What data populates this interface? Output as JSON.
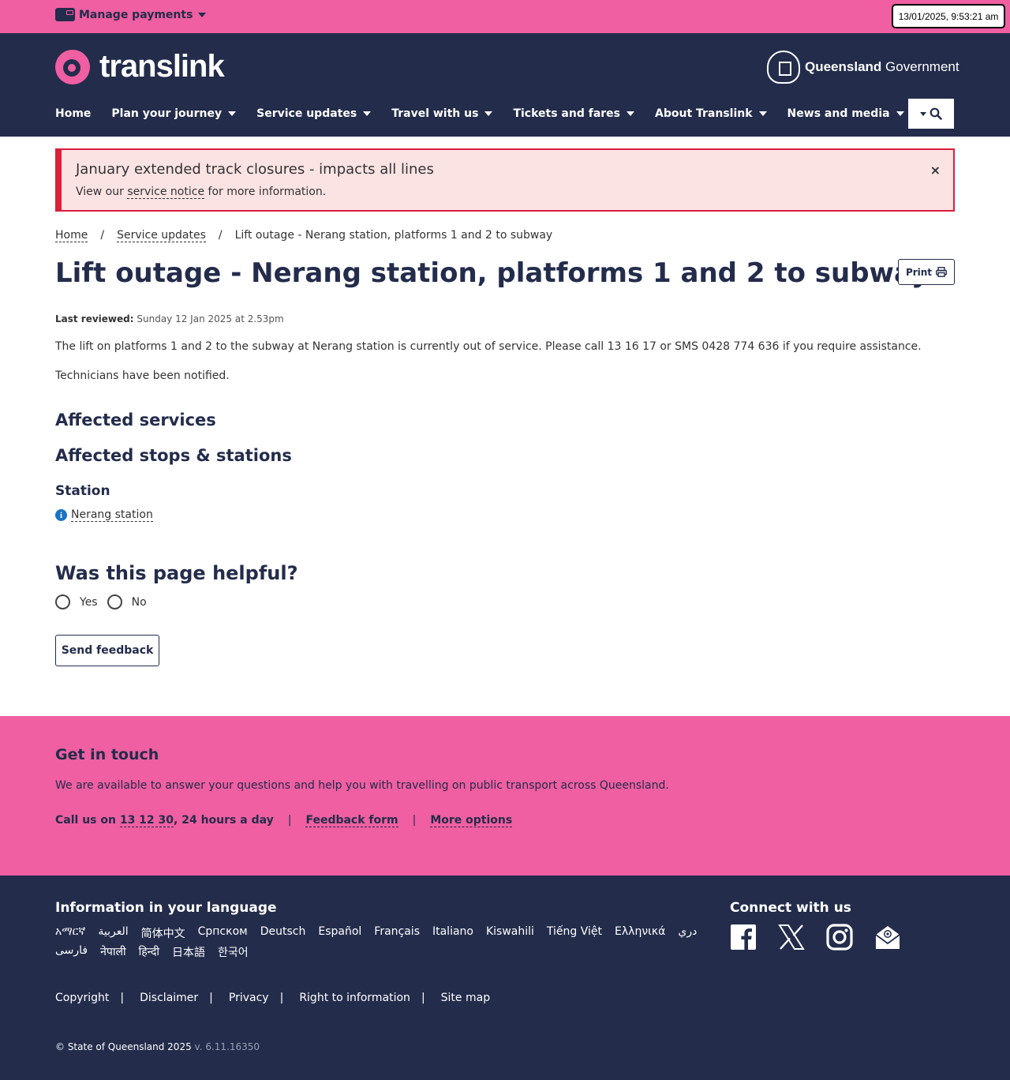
{
  "topbar": {
    "manage_label": "Manage payments",
    "clock": "13/01/2025, 9:53:21 am"
  },
  "header": {
    "logo_text": "translink",
    "gov_bold": "Queensland",
    "gov_rest": "Government",
    "nav": [
      {
        "label": "Home",
        "dropdown": false
      },
      {
        "label": "Plan your journey",
        "dropdown": true
      },
      {
        "label": "Service updates",
        "dropdown": true
      },
      {
        "label": "Travel with us",
        "dropdown": true
      },
      {
        "label": "Tickets and fares",
        "dropdown": true
      },
      {
        "label": "About Translink",
        "dropdown": true
      },
      {
        "label": "News and media",
        "dropdown": true
      }
    ]
  },
  "alert": {
    "title": "January extended track closures - impacts all lines",
    "body_pre": "View our ",
    "body_link": "service notice",
    "body_post": " for more information.",
    "close": "×"
  },
  "breadcrumb": {
    "items": [
      "Home",
      "Service updates",
      "Lift outage - Nerang station, platforms 1 and 2 to subway"
    ],
    "separator": "/"
  },
  "page": {
    "title": "Lift outage - Nerang station, platforms 1 and 2 to subway",
    "print_label": "Print",
    "reviewed_label": "Last reviewed:",
    "reviewed_value": "Sunday 12 Jan 2025 at 2.53pm",
    "para1": "The lift on platforms 1 and 2 to the subway at Nerang station is currently out of service. Please call 13 16 17 or SMS 0428 774 636 if you require assistance.",
    "para2": "Technicians have been notified.",
    "affected_services": "Affected services",
    "affected_stops": "Affected stops & stations",
    "station_heading": "Station",
    "station_link": "Nerang station"
  },
  "feedback": {
    "heading": "Was this page helpful?",
    "yes": "Yes",
    "no": "No",
    "send": "Send feedback"
  },
  "touch": {
    "heading": "Get in touch",
    "text": "We are available to answer your questions and help you with travelling on public transport across Queensland.",
    "call_pre": "Call us on ",
    "call_number": "13 12 30",
    "call_post": ", 24 hours a day",
    "feedback_form": "Feedback form",
    "more_options": "More options",
    "pipe": "|"
  },
  "footer": {
    "lang_heading": "Information in your language",
    "languages": [
      "አማርኛ",
      "العربية",
      "简体中文",
      "Српском",
      "Deutsch",
      "Español",
      "Français",
      "Italiano",
      "Kiswahili",
      "Tiếng Việt",
      "Ελληνικά",
      "دري",
      "فارسی",
      "नेपाली",
      "हिन्दी",
      "日本語",
      "한국어"
    ],
    "connect_heading": "Connect with us",
    "socials": [
      "facebook-icon",
      "x-icon",
      "instagram-icon",
      "email-icon"
    ],
    "links": [
      "Copyright",
      "Disclaimer",
      "Privacy",
      "Right to information",
      "Site map"
    ],
    "pipe": "|",
    "copyright": "© State of Queensland 2025",
    "version": "v. 6.11.16350"
  },
  "colors": {
    "pink": "#ef5fa1",
    "navy": "#232c4b",
    "alert_red": "#dc1f3c",
    "alert_bg": "#fbe3e4",
    "info_blue": "#1a73c4"
  }
}
